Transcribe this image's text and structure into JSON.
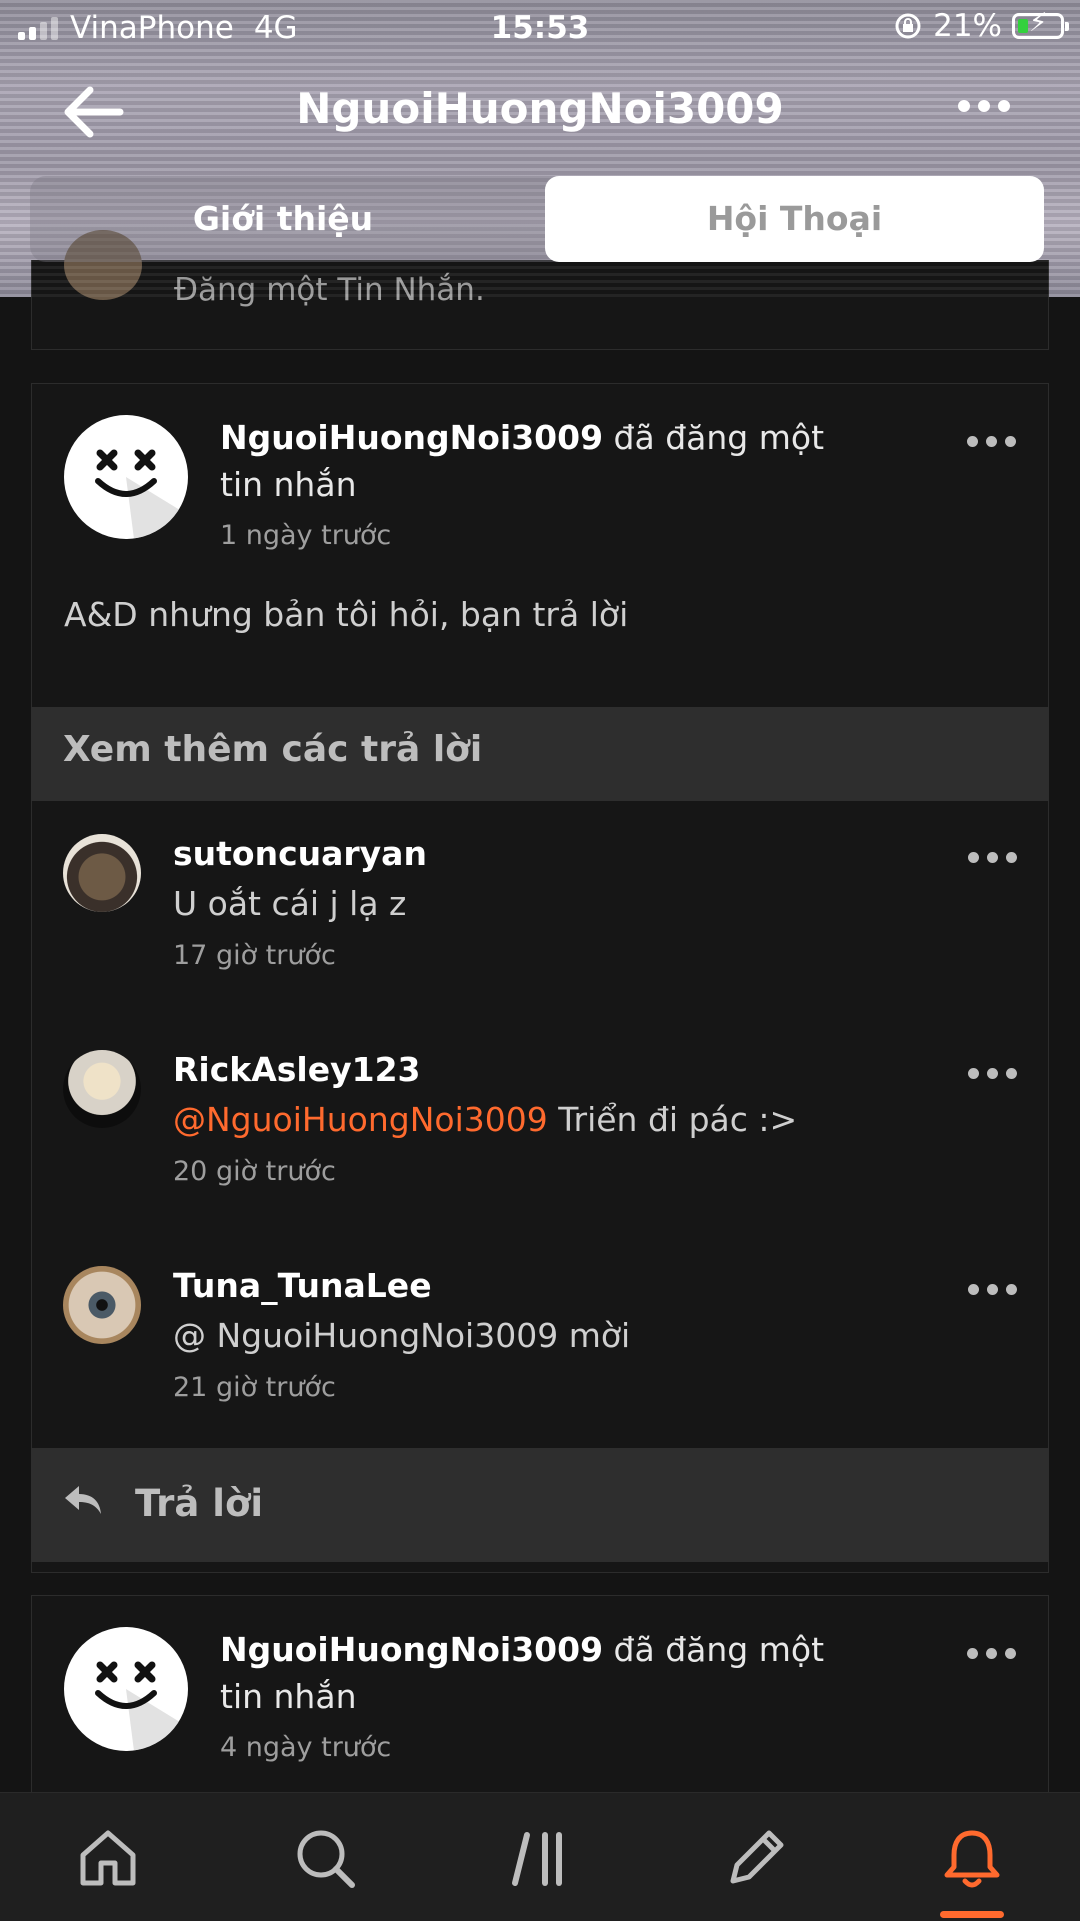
{
  "status_bar": {
    "carrier": "VinaPhone",
    "network": "4G",
    "time": "15:53",
    "battery": "21%"
  },
  "header": {
    "title": "NguoiHuongNoi3009"
  },
  "tabs": [
    {
      "label": "Giới thiệu",
      "selected": false
    },
    {
      "label": "Hội Thoại",
      "selected": true
    }
  ],
  "top_partial_text": "Đăng một Tin Nhắn.",
  "posts": [
    {
      "author": "NguoiHuongNoi3009",
      "action": " đã đăng một tin nhắn",
      "time": "1 ngày trước",
      "body": "A&D nhưng bản tôi hỏi, bạn trả lời"
    },
    {
      "author": "NguoiHuongNoi3009",
      "action": " đã đăng một tin nhắn",
      "time": "4 ngày trước"
    }
  ],
  "more_replies_label": "Xem thêm các trả lời",
  "replies": [
    {
      "name": "sutoncuaryan",
      "mention": "",
      "text": "U oắt cái j lạ z",
      "time": "17 giờ trước"
    },
    {
      "name": "RickAsley123",
      "mention": "@NguoiHuongNoi3009",
      "text": " Triển đi pác :>",
      "time": "20 giờ trước"
    },
    {
      "name": "Tuna_TunaLee",
      "mention": "",
      "text": "@ NguoiHuongNoi3009  mời",
      "time": "21 giờ trước"
    }
  ],
  "reply_button_label": "Trả lời",
  "bottom_nav": [
    {
      "icon": "home-icon"
    },
    {
      "icon": "search-icon"
    },
    {
      "icon": "library-icon"
    },
    {
      "icon": "pencil-icon"
    },
    {
      "icon": "bell-icon",
      "active": true
    }
  ],
  "colors": {
    "accent": "#ff6a2e",
    "background": "#141414",
    "panel": "#2e2e2e"
  }
}
